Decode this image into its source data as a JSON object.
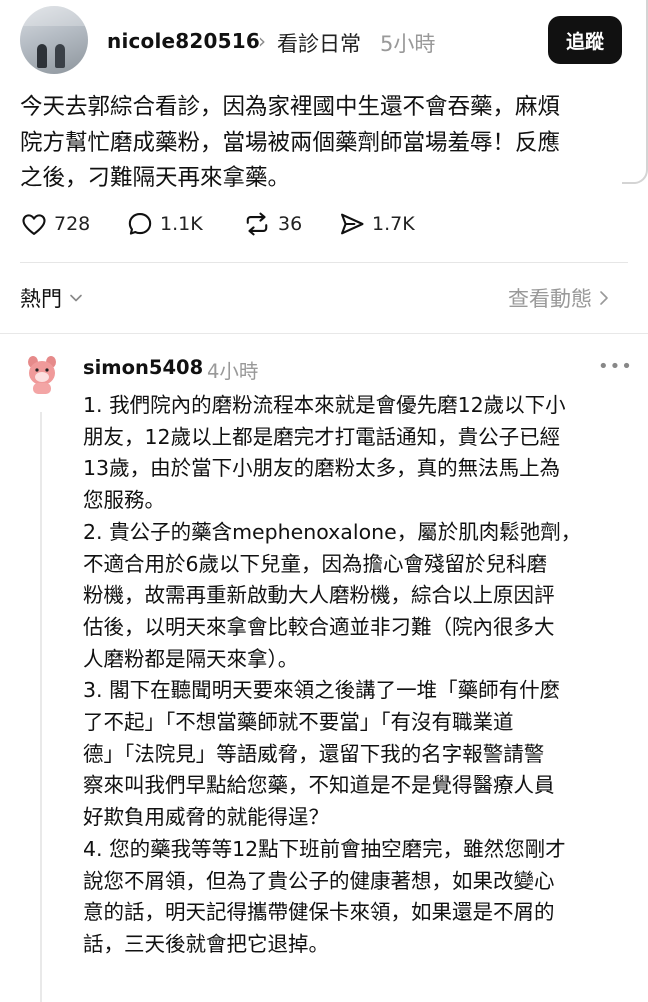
{
  "post": {
    "username": "nicole820516",
    "topic": "看診日常",
    "time": "5小時",
    "follow_label": "追蹤",
    "text_lines": [
      "今天去郭綜合看診，因為家裡國中生還不會吞藥，麻煩",
      "院方幫忙磨成藥粉，當場被兩個藥劑師當場羞辱！反應",
      "之後，刁難隔天再來拿藥。"
    ],
    "actions": {
      "likes": "728",
      "comments": "1.1K",
      "reposts": "36",
      "shares": "1.7K"
    }
  },
  "sort": {
    "label": "熱門",
    "view_activity": "查看動態"
  },
  "reply": {
    "username": "simon5408",
    "time": "4小時",
    "more": "•••",
    "lines": [
      "1. 我們院內的磨粉流程本來就是會優先磨12歲以下小",
      "朋友，12歲以上都是磨完才打電話通知，貴公子已經",
      "13歲，由於當下小朋友的磨粉太多，真的無法馬上為",
      "您服務。",
      "2. 貴公子的藥含mephenoxalone，屬於肌肉鬆弛劑，",
      "不適合用於6歲以下兒童，因為擔心會殘留於兒科磨",
      "粉機，故需再重新啟動大人磨粉機，綜合以上原因評",
      "估後，以明天來拿會比較合適並非刁難（院內很多大",
      "人磨粉都是隔天來拿）。",
      "3. 閣下在聽聞明天要來領之後講了一堆「藥師有什麼",
      "了不起」「不想當藥師就不要當」「有沒有職業道",
      "德」「法院見」等語威脅，還留下我的名字報警請警",
      "察來叫我們早點給您藥，不知道是不是覺得醫療人員",
      "好欺負用威脅的就能得逞？",
      "4. 您的藥我等等12點下班前會抽空磨完，雖然您剛才",
      "說您不屑領，但為了貴公子的健康著想，如果改變心",
      "意的話，明天記得攜帶健保卡來領，如果還是不屑的",
      "話，三天後就會把它退掉。"
    ]
  }
}
